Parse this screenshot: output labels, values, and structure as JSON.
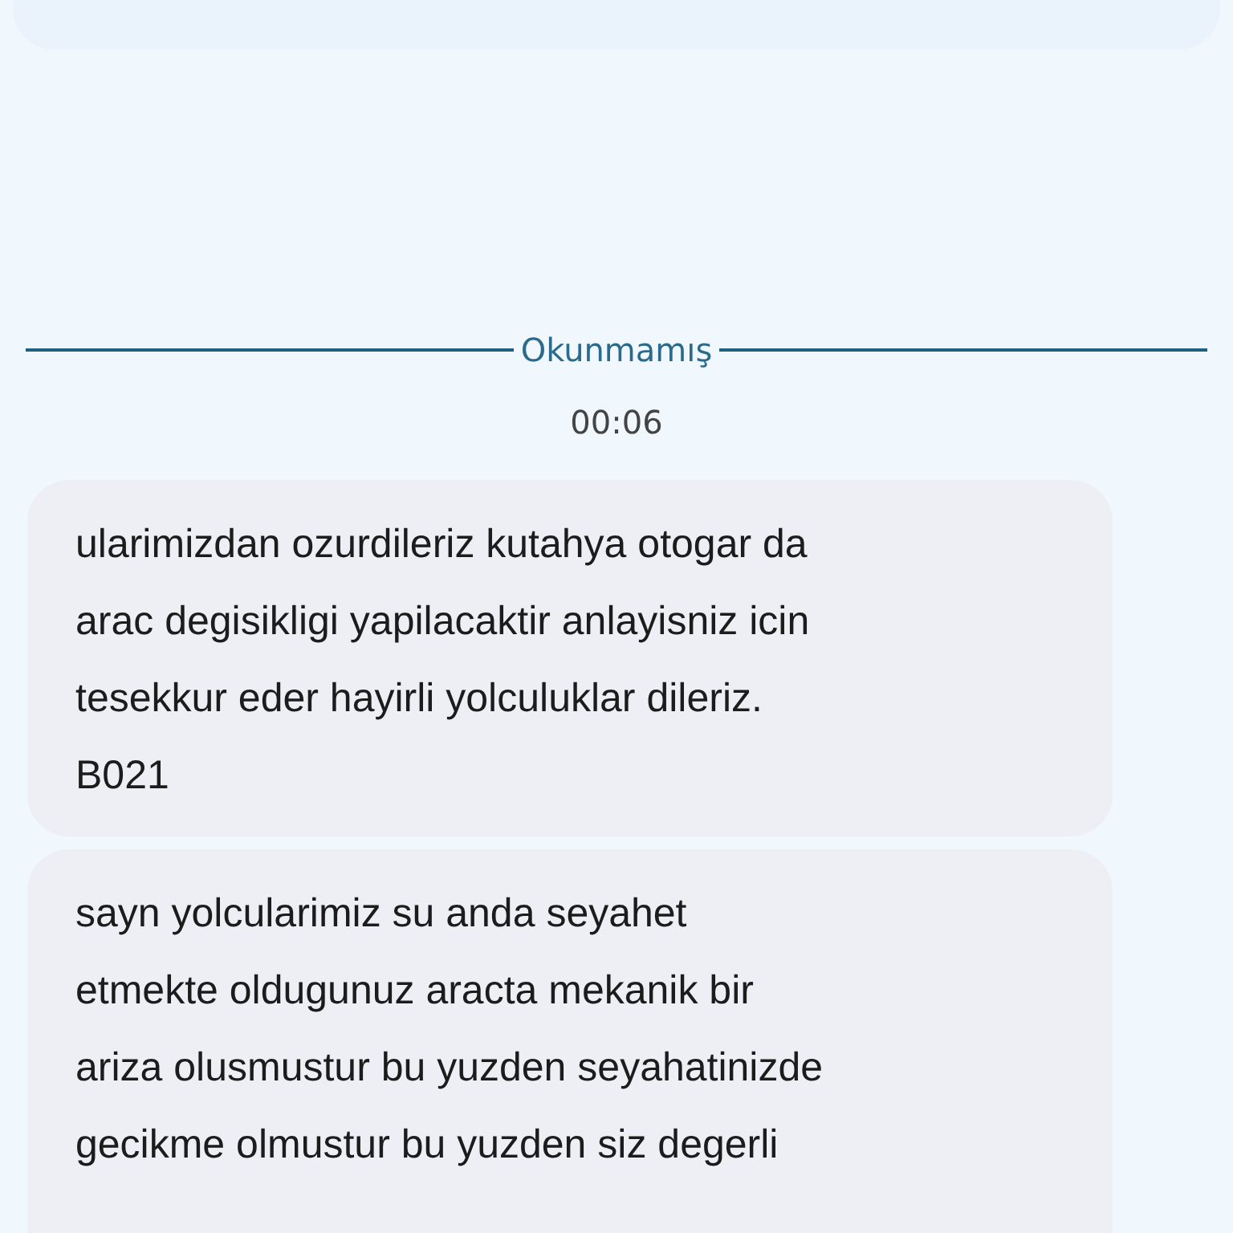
{
  "divider": {
    "label": "Okunmamış"
  },
  "timestamp": "00:06",
  "messages": [
    {
      "text": "ularimizdan ozurdileriz kutahya otogar da\narac degisikligi yapilacaktir anlayisniz icin\ntesekkur eder hayirli yolculuklar dileriz.\nB021"
    },
    {
      "text": "sayn yolcularimiz su anda seyahet\netmekte oldugunuz aracta mekanik bir\nariza olusmustur bu yuzden seyahatinizde\ngecikme olmustur bu yuzden siz degerli"
    }
  ]
}
